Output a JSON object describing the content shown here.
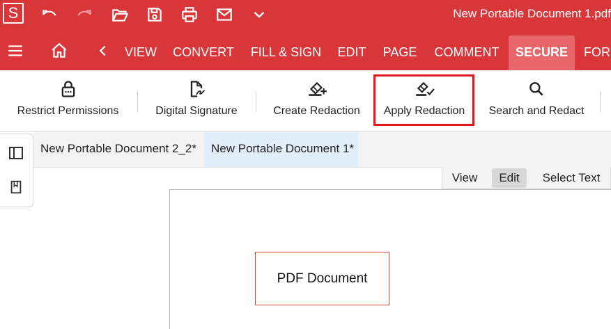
{
  "app": {
    "logo_letter": "S",
    "document_title": "New Portable Document 1.pdf"
  },
  "quick_access": [
    "undo-icon",
    "redo-icon",
    "open-folder-icon",
    "save-icon",
    "print-icon",
    "email-icon",
    "chevron-down-icon"
  ],
  "menu": {
    "tabs": [
      {
        "label": "VIEW"
      },
      {
        "label": "CONVERT"
      },
      {
        "label": "FILL & SIGN"
      },
      {
        "label": "EDIT"
      },
      {
        "label": "PAGE"
      },
      {
        "label": "COMMENT"
      },
      {
        "label": "SECURE",
        "active": true
      },
      {
        "label": "FORM"
      }
    ]
  },
  "ribbon": {
    "buttons": [
      {
        "label": "Restrict Permissions",
        "icon": "lock-icon"
      },
      {
        "label": "Digital Signature",
        "icon": "signature-icon"
      },
      {
        "label": "Create Redaction",
        "icon": "eraser-plus-icon"
      },
      {
        "label": "Apply Redaction",
        "icon": "eraser-check-icon",
        "highlighted": true
      },
      {
        "label": "Search and Redact",
        "icon": "search-icon"
      }
    ]
  },
  "left_panel": [
    "panel-toggle-icon",
    "bookmark-icon"
  ],
  "doc_tabs": [
    {
      "label": "New Portable Document 2_2*"
    },
    {
      "label": "New Portable Document 1*",
      "active": true
    }
  ],
  "view_modes": [
    {
      "label": "View"
    },
    {
      "label": "Edit",
      "active": true
    },
    {
      "label": "Select Text"
    }
  ],
  "document": {
    "redaction_text": "PDF Document"
  },
  "colors": {
    "brand_red": "#d9363a",
    "active_tab": "#e8676a",
    "highlight_border": "#e8141b",
    "redaction_border": "#e0483c"
  }
}
